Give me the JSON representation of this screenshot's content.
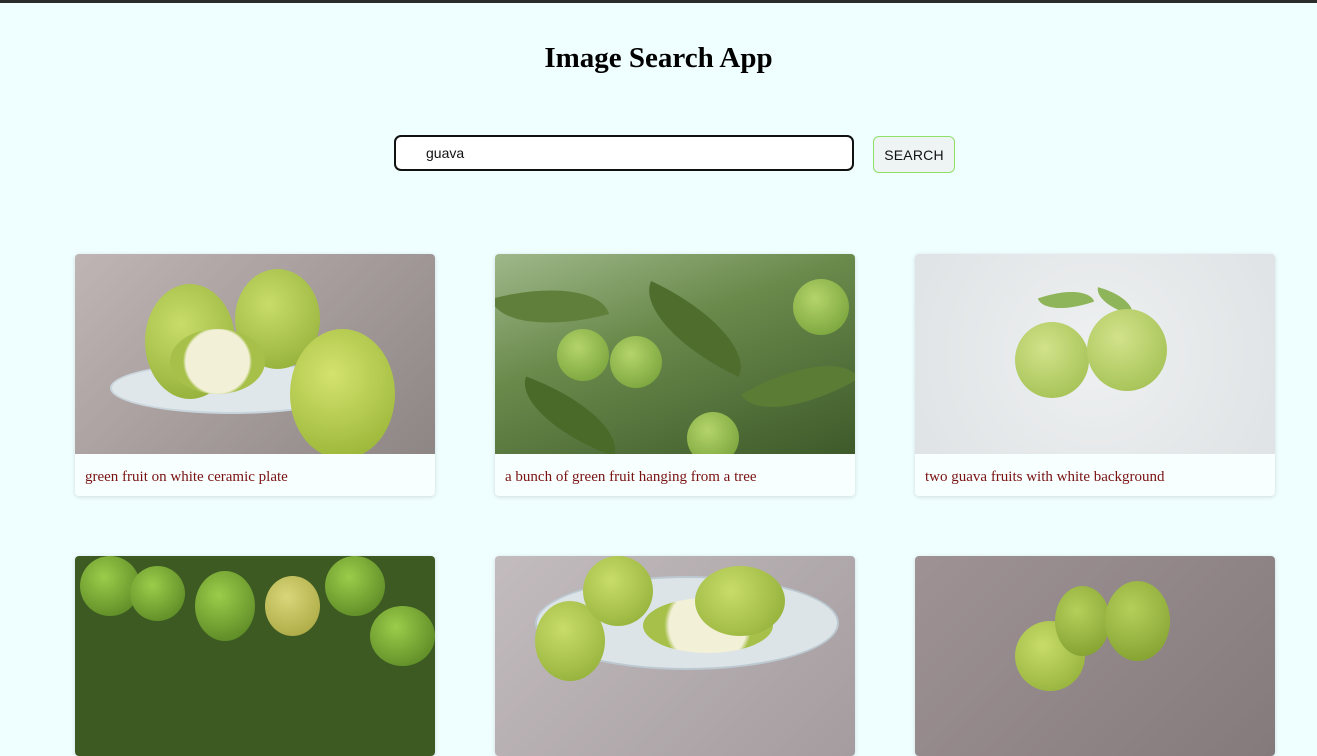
{
  "app": {
    "title": "Image Search App"
  },
  "search": {
    "value": "guava",
    "button_label": "SEARCH"
  },
  "results": [
    {
      "caption": "green fruit on white ceramic plate"
    },
    {
      "caption": "a bunch of green fruit hanging from a tree"
    },
    {
      "caption": "two guava fruits with white background"
    },
    {
      "caption": ""
    },
    {
      "caption": ""
    },
    {
      "caption": ""
    }
  ],
  "colors": {
    "background": "#effefe",
    "caption_text": "#7a1212",
    "button_border": "#8fe06b"
  }
}
